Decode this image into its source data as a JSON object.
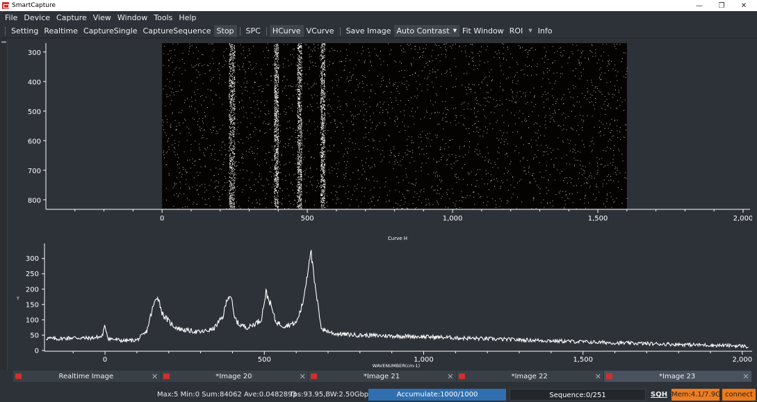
{
  "window": {
    "title": "SmartCapture",
    "controls": [
      "minimize-icon",
      "restore-icon",
      "close-icon"
    ]
  },
  "menu": [
    "File",
    "Device",
    "Capture",
    "View",
    "Window",
    "Tools",
    "Help"
  ],
  "toolbar": {
    "setting": "Setting",
    "realtime": "Realtime",
    "capture_single": "CaptureSingle",
    "capture_sequence": "CaptureSequence",
    "stop": "Stop",
    "spc": "SPC",
    "hcurve": "HCurve",
    "vcurve": "VCurve",
    "save_image": "Save Image",
    "auto_contrast": "Auto Contrast",
    "fit_window": "Fit Window",
    "roi": "ROI",
    "info": "Info"
  },
  "image_view": {
    "y_ticks": [
      "300",
      "400",
      "500",
      "600",
      "700",
      "800"
    ],
    "x_ticks": [
      "0",
      "500",
      "1,000",
      "1,500",
      "2,000"
    ],
    "image_extent_x": [
      0,
      1600
    ],
    "image_extent_y": [
      270,
      830
    ],
    "x_range": [
      -400,
      2000
    ],
    "bright_columns": [
      230,
      250,
      385,
      400,
      465,
      480,
      545,
      560
    ]
  },
  "chart_data": {
    "type": "line",
    "title": "Curve H",
    "xlabel": "WAVENUMBER(cm-1)",
    "ylabel": "Y",
    "xlim": [
      -190,
      2020
    ],
    "ylim": [
      0,
      340
    ],
    "x_ticks": [
      "0",
      "500",
      "1,000",
      "1,500",
      "2,000"
    ],
    "y_ticks": [
      "0",
      "50",
      "100",
      "150",
      "200",
      "250",
      "300"
    ],
    "grid": false,
    "series": [
      {
        "name": "",
        "x": [
          -185,
          -150,
          -100,
          -50,
          -10,
          0,
          10,
          30,
          60,
          100,
          130,
          150,
          165,
          180,
          200,
          215,
          235,
          260,
          300,
          340,
          370,
          385,
          395,
          405,
          420,
          450,
          490,
          505,
          520,
          535,
          560,
          600,
          620,
          635,
          645,
          660,
          680,
          720,
          800,
          1000,
          1200,
          1400,
          1600,
          1800,
          2000,
          2020
        ],
        "y": [
          40,
          38,
          42,
          40,
          45,
          80,
          40,
          36,
          32,
          34,
          60,
          140,
          180,
          120,
          95,
          80,
          70,
          65,
          60,
          70,
          110,
          175,
          180,
          110,
          85,
          75,
          100,
          190,
          150,
          95,
          80,
          90,
          150,
          250,
          330,
          200,
          70,
          55,
          50,
          45,
          38,
          32,
          25,
          20,
          15,
          12
        ]
      }
    ]
  },
  "tabs": [
    {
      "label": "Realtime Image",
      "selected": false
    },
    {
      "label": "*Image 20",
      "selected": false
    },
    {
      "label": "*Image 21",
      "selected": false
    },
    {
      "label": "*Image 22",
      "selected": false
    },
    {
      "label": "*Image 23",
      "selected": true
    }
  ],
  "status": {
    "stats": "Max:5 Min:0 Sum:84062 Ave:0.0482893",
    "fps": "fps:93.95,BW:2.50Gbps",
    "accumulate": "Accumulate:1000/1000",
    "sequence": "Sequence:0/251",
    "sqh": "SQH",
    "mem": "Mem:4.1/7.9G",
    "connect": "connect"
  },
  "colors": {
    "accent_blue": "#2f6fb0",
    "mem_orange": "#ef7d20",
    "connect_orange": "#f07a18",
    "panel": "#2d3238"
  }
}
